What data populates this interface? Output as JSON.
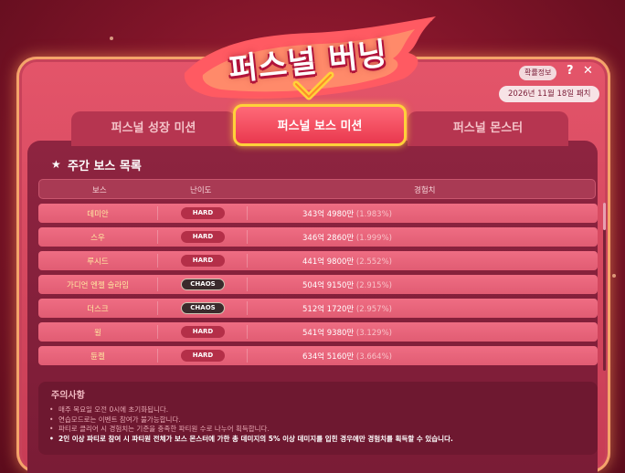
{
  "header": {
    "title": "퍼스널 버닝",
    "info_button": "확률정보",
    "help": "?",
    "close": "✕",
    "date": "2026년 11월 18일 패치"
  },
  "tabs": [
    {
      "label": "퍼스널 성장 미션",
      "active": false
    },
    {
      "label": "퍼스널 보스 미션",
      "active": true
    },
    {
      "label": "퍼스널 몬스터",
      "active": false
    }
  ],
  "section": {
    "icon": "star-icon",
    "title": "주간 보스 목록"
  },
  "table": {
    "headers": {
      "boss": "보스",
      "difficulty": "난이도",
      "exp": "경험치"
    },
    "rows": [
      {
        "name": "데미안",
        "difficulty": "HARD",
        "exp": "343억 4980만",
        "pct": "(1.983%)"
      },
      {
        "name": "스우",
        "difficulty": "HARD",
        "exp": "346억 2860만",
        "pct": "(1.999%)"
      },
      {
        "name": "루시드",
        "difficulty": "HARD",
        "exp": "441억 9800만",
        "pct": "(2.552%)"
      },
      {
        "name": "가디언 엔젤 슬라임",
        "difficulty": "CHAOS",
        "exp": "504억 9150만",
        "pct": "(2.915%)"
      },
      {
        "name": "더스크",
        "difficulty": "CHAOS",
        "exp": "512억 1720만",
        "pct": "(2.957%)"
      },
      {
        "name": "윌",
        "difficulty": "HARD",
        "exp": "541억 9380만",
        "pct": "(3.129%)"
      },
      {
        "name": "듄켈",
        "difficulty": "HARD",
        "exp": "634억 5160만",
        "pct": "(3.664%)"
      }
    ]
  },
  "notes": {
    "title": "주의사항",
    "items": [
      "매주 목요일 오전 0시에 초기화됩니다.",
      "연습모드로는 이벤트 참여가 불가능합니다.",
      "파티로 클리어 시 경험치는 기준을 충족한 파티원 수로 나누어 획득합니다.",
      "2인 이상 파티로 참여 시 파티원 전체가 보스 몬스터에 가한 총 데미지의 5% 이상 데미지를 입힌 경우에만 경험치를 획득할 수 있습니다."
    ]
  },
  "colors": {
    "accent": "#ffd23a",
    "window": "#e4556a",
    "panel": "#8e2440"
  }
}
